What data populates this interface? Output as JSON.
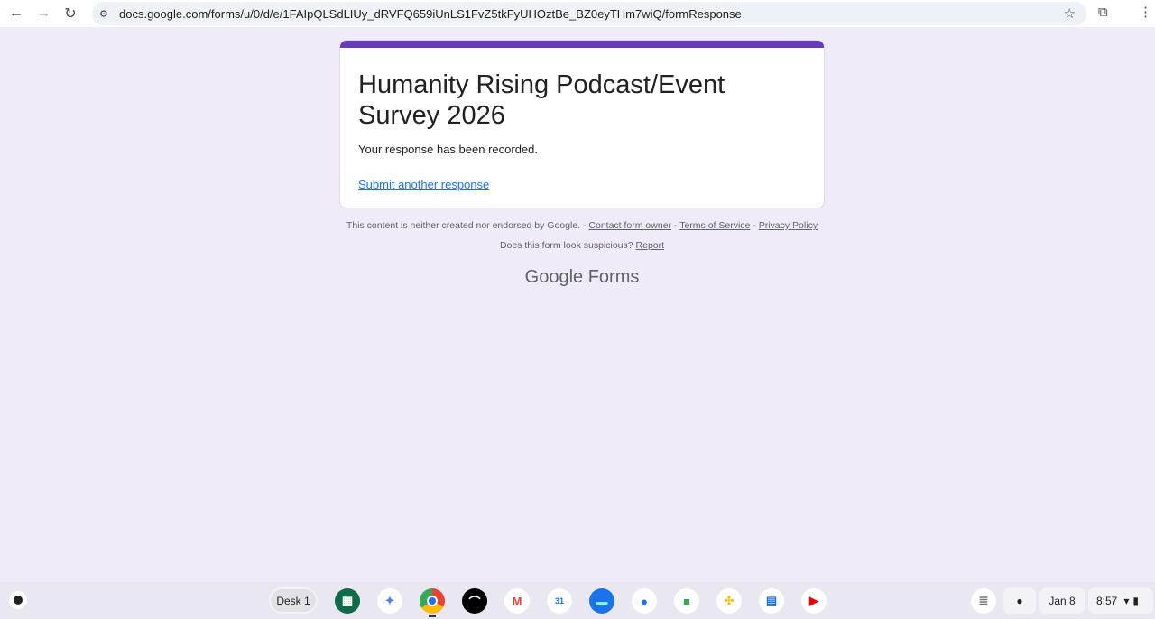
{
  "browser": {
    "url": "docs.google.com/forms/u/0/d/e/1FAIpQLSdLIUy_dRVFQ659iUnLS1FvZ5tkFyUHOztBe_BZ0eyTHm7wiQ/formResponse"
  },
  "form": {
    "title": "Humanity Rising Podcast/Event Survey 2026",
    "message": "Your response has been recorded.",
    "submit_another": "Submit another response",
    "accent": "#673ab7"
  },
  "footer": {
    "disclaimer": "This content is neither created nor endorsed by Google. - ",
    "contact": "Contact form owner",
    "sep": " - ",
    "terms": "Terms of Service",
    "privacy": "Privacy Policy",
    "suspicious": "Does this form look suspicious? ",
    "report": "Report",
    "logo_google": "Google",
    "logo_forms": " Forms"
  },
  "shelf": {
    "desk": "Desk 1",
    "date": "Jan 8",
    "time": "8:57",
    "apps": [
      "app-grid",
      "gemini",
      "chrome",
      "audible",
      "gmail",
      "calendar",
      "files",
      "messages",
      "meet",
      "photos",
      "docs",
      "youtube"
    ],
    "calendar_day": "31"
  }
}
